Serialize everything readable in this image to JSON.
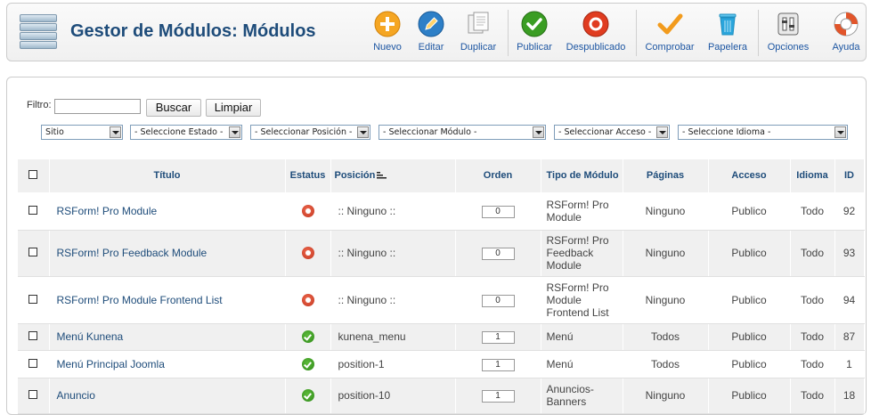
{
  "header": {
    "title": "Gestor de Módulos: Módulos"
  },
  "toolbar": {
    "buttons": [
      {
        "label": "Nuevo",
        "icon": "plus-circle-icon",
        "color": "#f5a623"
      },
      {
        "label": "Editar",
        "icon": "pencil-icon",
        "color": "#2d7fc7"
      },
      {
        "label": "Duplicar",
        "icon": "copy-icon",
        "color": "#9a9a9a"
      },
      {
        "label": "Publicar",
        "icon": "checkmark-icon",
        "color": "#3a9d23"
      },
      {
        "label": "Despublicado",
        "icon": "unpublish-icon",
        "color": "#e03c20"
      },
      {
        "label": "Comprobar",
        "icon": "check-tick-icon",
        "color": "#f29b1d"
      },
      {
        "label": "Papelera",
        "icon": "trash-icon",
        "color": "#2aa5dc"
      },
      {
        "label": "Opciones",
        "icon": "options-icon",
        "color": "#555555"
      },
      {
        "label": "Ayuda",
        "icon": "lifebuoy-icon",
        "color": "#e2552a"
      }
    ]
  },
  "filters": {
    "filter_label": "Filtro:",
    "filter_value": "",
    "search_label": "Buscar",
    "reset_label": "Limpiar",
    "selects": [
      "Sitio",
      "- Seleccione Estado -",
      "- Seleccionar Posición -",
      "- Seleccionar Módulo -",
      "- Seleccionar Acceso -",
      "- Seleccione Idioma -"
    ]
  },
  "table": {
    "headers": {
      "title": "Título",
      "status": "Estatus",
      "position": "Posición",
      "order": "Orden",
      "type": "Tipo de Módulo",
      "pages": "Páginas",
      "access": "Acceso",
      "language": "Idioma",
      "id": "ID"
    },
    "rows": [
      {
        "title": "RSForm! Pro Module",
        "status": "unpublished",
        "position": ":: Ninguno ::",
        "order": "0",
        "type": "RSForm! Pro Module",
        "pages": "Ninguno",
        "access": "Publico",
        "language": "Todo",
        "id": "92"
      },
      {
        "title": "RSForm! Pro Feedback Module",
        "status": "unpublished",
        "position": ":: Ninguno ::",
        "order": "0",
        "type": "RSForm! Pro Feedback Module",
        "pages": "Ninguno",
        "access": "Publico",
        "language": "Todo",
        "id": "93"
      },
      {
        "title": "RSForm! Pro Module Frontend List",
        "status": "unpublished",
        "position": ":: Ninguno ::",
        "order": "0",
        "type": "RSForm! Pro Module Frontend List",
        "pages": "Ninguno",
        "access": "Publico",
        "language": "Todo",
        "id": "94"
      },
      {
        "title": "Menú Kunena",
        "status": "published",
        "position": "kunena_menu",
        "order": "1",
        "type": "Menú",
        "pages": "Todos",
        "access": "Publico",
        "language": "Todo",
        "id": "87"
      },
      {
        "title": "Menú Principal Joomla",
        "status": "published",
        "position": "position-1",
        "order": "1",
        "type": "Menú",
        "pages": "Todos",
        "access": "Publico",
        "language": "Todo",
        "id": "1"
      },
      {
        "title": "Anuncio",
        "status": "published",
        "position": "position-10",
        "order": "1",
        "type": "Anuncios-Banners",
        "pages": "Ninguno",
        "access": "Publico",
        "language": "Todo",
        "id": "18"
      }
    ]
  }
}
